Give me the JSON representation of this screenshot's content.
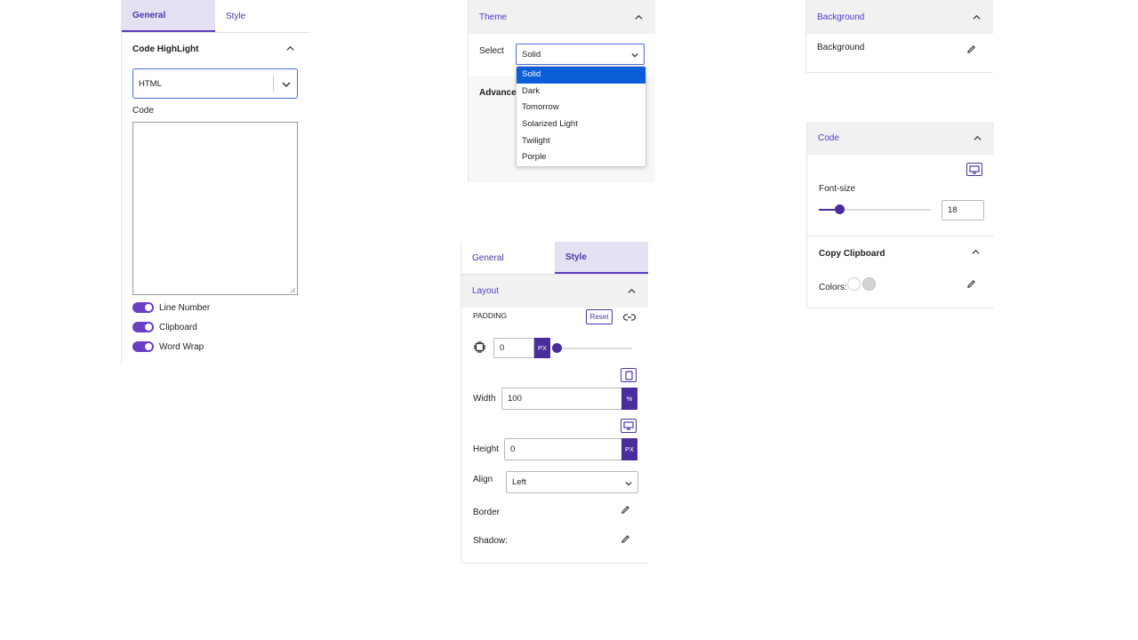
{
  "panel1": {
    "tabs": {
      "general": "General",
      "style": "Style"
    },
    "section_title": "Code HighLight",
    "language_value": "HTML",
    "code_label": "Code",
    "toggles": [
      "Line Number",
      "Clipboard",
      "Word Wrap"
    ]
  },
  "panel2": {
    "header": "Theme",
    "select_label": "Select",
    "select_value": "Solid",
    "advanced_label": "Advanced",
    "options": [
      "Solid",
      "Dark",
      "Tomorrow",
      "Solarized Light",
      "Twilight",
      "Porple"
    ]
  },
  "panel3": {
    "header": "Background",
    "label": "Background"
  },
  "panel4": {
    "header": "Code",
    "font_size_label": "Font-size",
    "font_size_value": "18",
    "copy_title": "Copy Clipboard",
    "colors_label": "Colors:"
  },
  "panel5": {
    "tabs": {
      "general": "General",
      "style": "Style"
    },
    "layout_header": "Layout",
    "padding_label": "PADDING",
    "reset_label": "Reset",
    "padding_value": "0",
    "padding_unit": "PX",
    "width_label": "Width",
    "width_value": "100",
    "width_unit": "%",
    "height_label": "Height",
    "height_value": "0",
    "height_unit": "PX",
    "align_label": "Align",
    "align_value": "Left",
    "border_label": "Border",
    "shadow_label": "Shadow:"
  },
  "colors": {
    "accent": "#4b35a6",
    "toggle": "#6a3fc3",
    "selection": "#0b5dd8"
  }
}
